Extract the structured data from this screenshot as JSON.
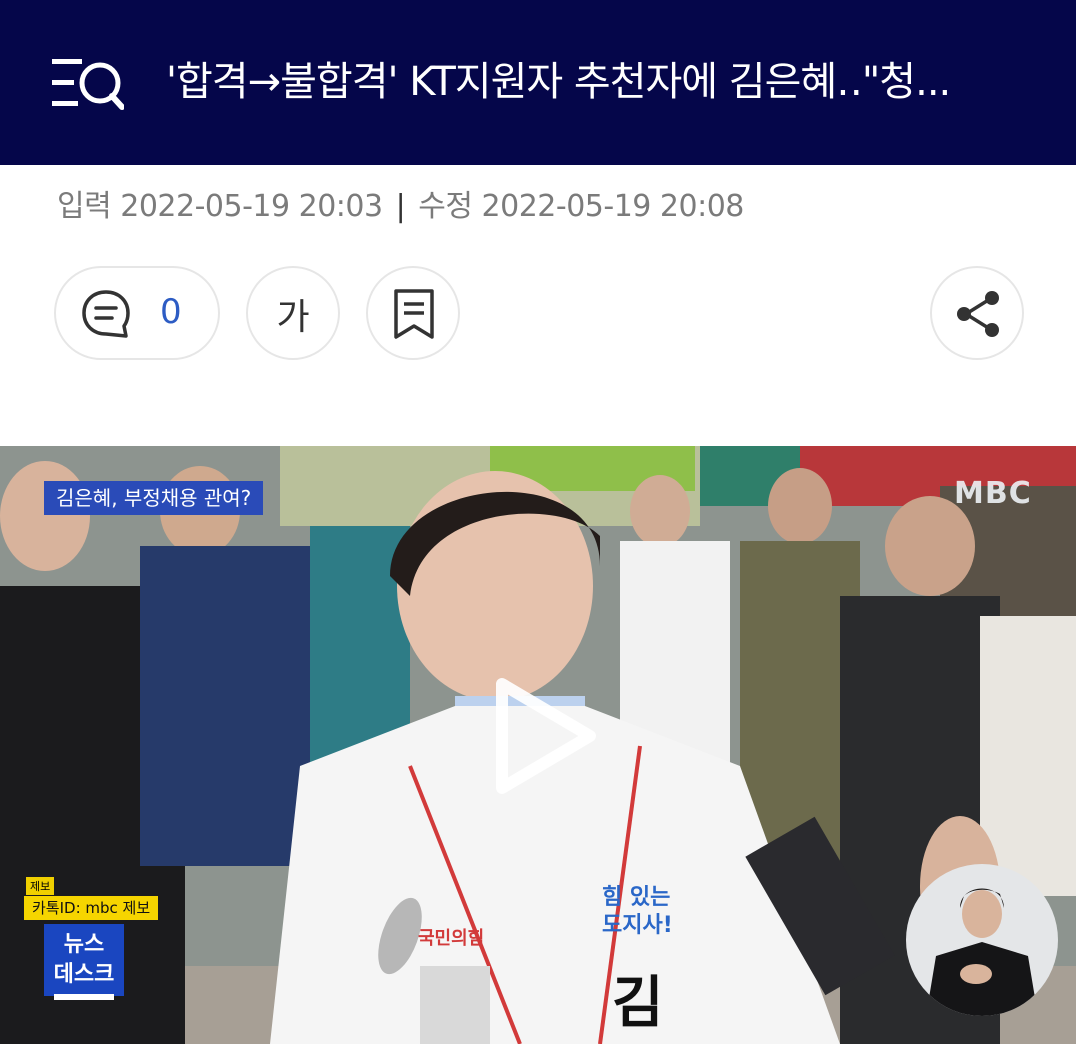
{
  "header": {
    "title": "'합격→불합격' KT지원자 추천자에 김은혜‥\"청...",
    "menu_search_icon": "menu-search-icon",
    "background": "#05064a"
  },
  "meta": {
    "input_label": "입력",
    "input_time": "2022-05-19 20:03",
    "separator": "|",
    "edit_label": "수정",
    "edit_time": "2022-05-19 20:08"
  },
  "actions": {
    "comment_icon": "comment-icon",
    "comment_count": "0",
    "font_size_label": "가",
    "bookmark_icon": "bookmark-icon",
    "share_icon": "share-icon",
    "accent": "#2d5cc4"
  },
  "video": {
    "caption": "김은혜, 부정채용 관여?",
    "watermark": "MBC",
    "report_small": "제보",
    "report_tag": "카톡ID: mbc 제보",
    "program_line1": "뉴스",
    "program_line2": "데스크",
    "vest_slogan_line1": "힘 있는",
    "vest_slogan_line2": "도지사!",
    "vest_party": "국민의힘",
    "vest_name": "김",
    "play_icon": "play-icon"
  }
}
